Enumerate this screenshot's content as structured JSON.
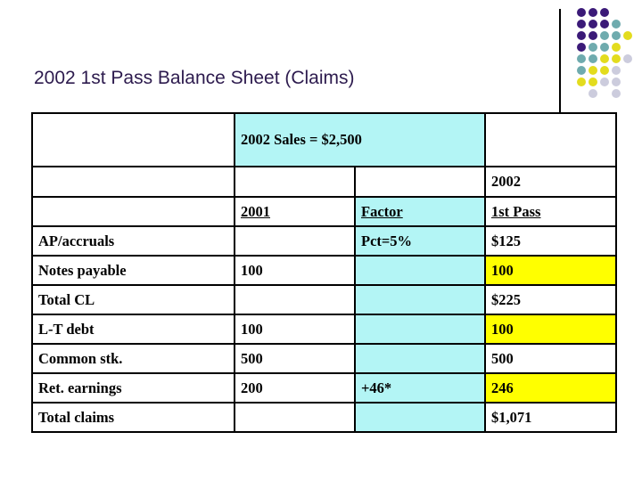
{
  "slide": {
    "title": "2002 1st Pass Balance Sheet (Claims)"
  },
  "decor": {
    "dot_grid_name": "decorative-dot-grid",
    "colors": {
      "purple": "#3b1a78",
      "teal": "#6fabae",
      "yellow": "#e3dc1e",
      "lavender": "#ccccdd"
    },
    "rule_name": "vertical-rule"
  },
  "table": {
    "sales_banner": "2002 Sales = $2,500",
    "year_label": "2002",
    "headers": {
      "col1": "",
      "col2": "2001",
      "col3": "Factor",
      "col4": "1st Pass"
    },
    "accent_colors": {
      "cyan": "#b3f5f5",
      "yellow": "#ffff00"
    },
    "rows": [
      {
        "label": "AP/accruals",
        "col2": "",
        "col3": "Pct=5%",
        "col4": "$125",
        "col4_highlight": "white",
        "indent": false
      },
      {
        "label": "Notes payable",
        "col2": "100",
        "col3": "",
        "col4": "100",
        "col4_highlight": "yellow",
        "indent": false
      },
      {
        "label": "Total CL",
        "col2": "",
        "col3": "",
        "col4": "$225",
        "col4_highlight": "white",
        "indent": true
      },
      {
        "label": "L-T debt",
        "col2": "100",
        "col3": "",
        "col4": "100",
        "col4_highlight": "yellow",
        "indent": false
      },
      {
        "label": "Common stk.",
        "col2": "500",
        "col3": "",
        "col4": "500",
        "col4_highlight": "white",
        "indent": false
      },
      {
        "label": "Ret. earnings",
        "col2": "200",
        "col3": "+46*",
        "col4": "246",
        "col4_highlight": "yellow",
        "indent": false
      },
      {
        "label": "Total claims",
        "col2": "",
        "col3": "",
        "col4": "$1,071",
        "col4_highlight": "white",
        "indent": false
      }
    ]
  }
}
